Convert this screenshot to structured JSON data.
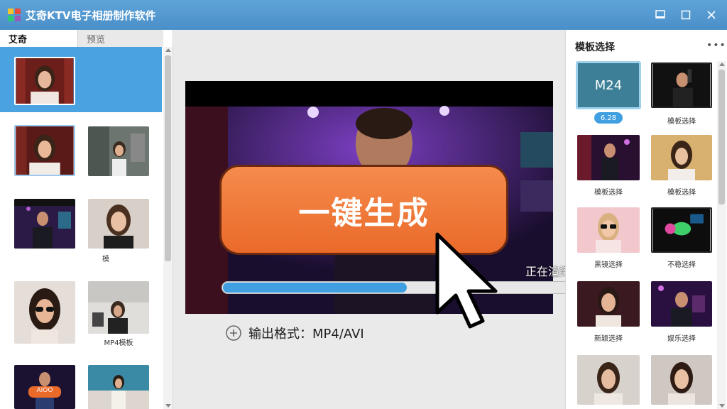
{
  "window": {
    "title": "艾奇KTV电子相册制作软件"
  },
  "left_panel": {
    "tabs": [
      {
        "label": "艾奇"
      },
      {
        "label": "预览"
      }
    ],
    "thumbnails": [
      {
        "caption": ""
      },
      {
        "caption": ""
      },
      {
        "caption": ""
      },
      {
        "caption": ""
      },
      {
        "caption": "模"
      },
      {
        "caption": ""
      },
      {
        "caption": "MP4模板"
      },
      {
        "caption": ""
      },
      {
        "caption": ""
      }
    ],
    "thumb_overlay_text": "AIOO"
  },
  "preview": {
    "generate_button": "一键生成",
    "progress_label": "正在渲染",
    "progress": 0.48,
    "output_format": "输出格式：MP4/AVI"
  },
  "right_panel": {
    "title": "模板选择",
    "more": "•••",
    "templates": [
      {
        "label": "M24",
        "caption": "6.28"
      },
      {
        "caption": "模板选择"
      },
      {
        "caption": "模板选择"
      },
      {
        "caption": "模板选择"
      },
      {
        "caption": "黑镜选择"
      },
      {
        "caption": "不稳选择"
      },
      {
        "caption": "新颖选择"
      },
      {
        "caption": "娱乐选择"
      },
      {
        "caption": ""
      },
      {
        "caption": ""
      }
    ]
  },
  "colors": {
    "titlebar": "#4a8fc8",
    "accent_blue": "#3f9fe0",
    "generate_orange": "#ea6a2a"
  }
}
